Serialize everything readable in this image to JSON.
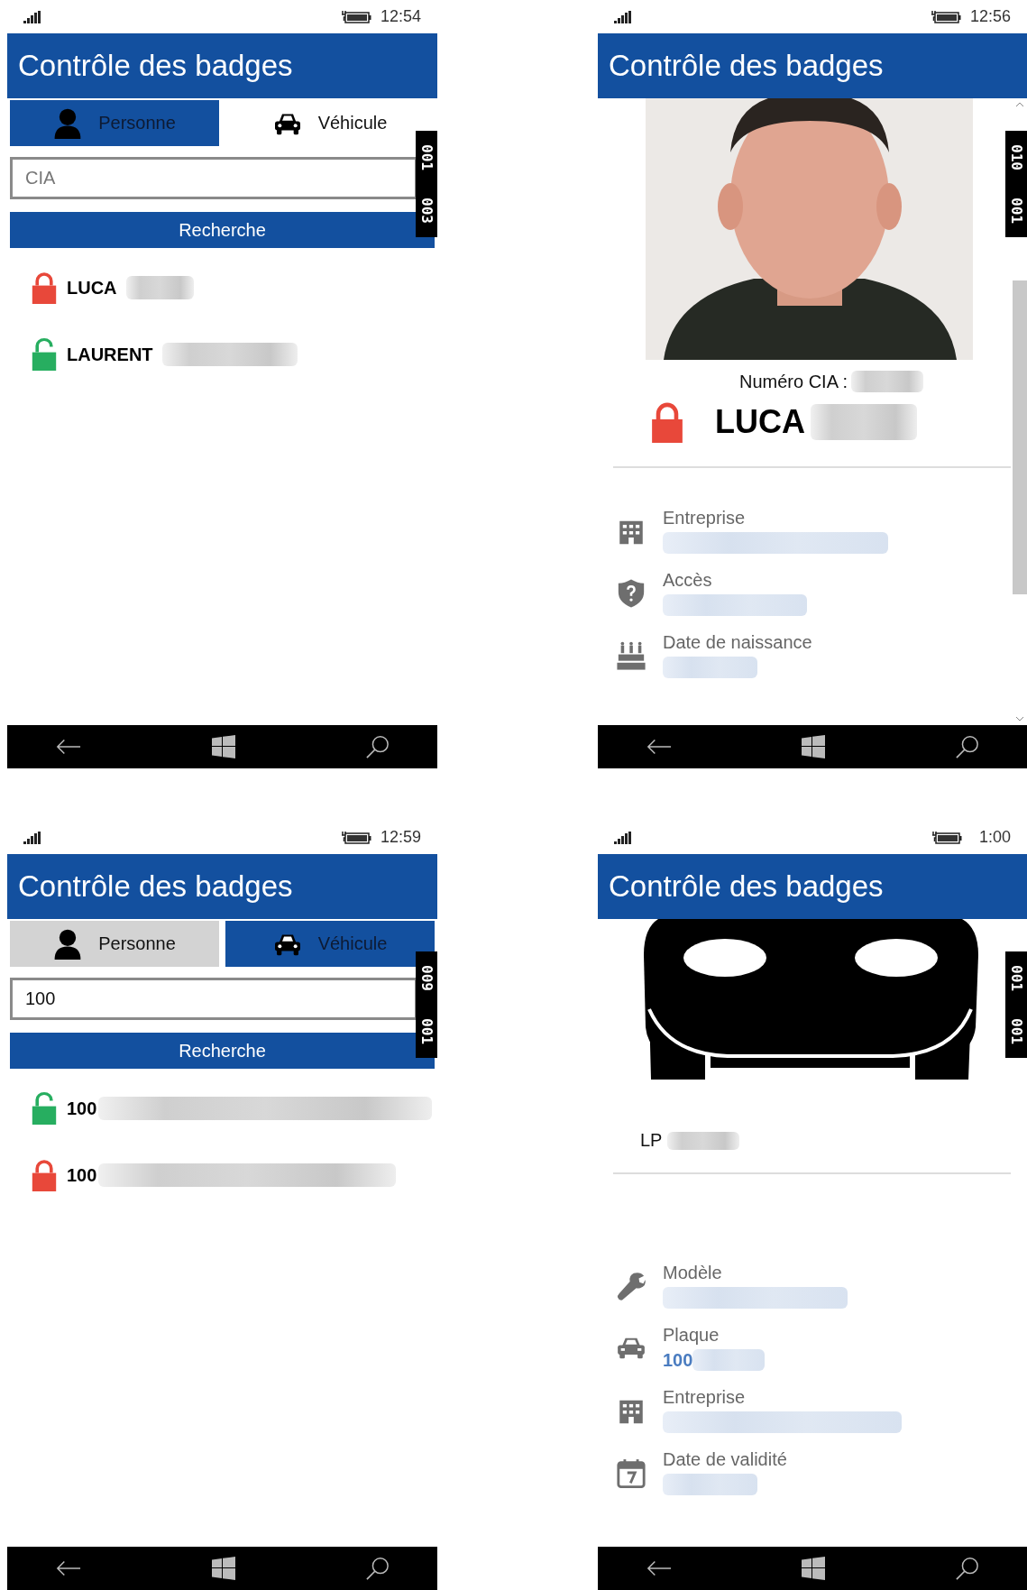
{
  "screens": [
    {
      "kind": "search",
      "time": "12:54",
      "title": "Contrôle des badges",
      "tabs": [
        {
          "label": "Personne",
          "selected": true,
          "pressed": false
        },
        {
          "label": "Véhicule",
          "selected": false,
          "pressed": false
        }
      ],
      "search": {
        "placeholder": "CIA"
      },
      "button": "Recherche",
      "results": [
        {
          "name": "LUCA",
          "locked": true
        },
        {
          "name": "LAURENT",
          "locked": false
        }
      ],
      "counter": [
        "001",
        "003"
      ]
    },
    {
      "kind": "person_detail",
      "time": "12:56",
      "title": "Contrôle des badges",
      "number_label": "Numéro CIA :",
      "locked": true,
      "name": "LUCA",
      "fields": [
        {
          "kind": "company",
          "label": "Entreprise"
        },
        {
          "kind": "access",
          "label": "Accès"
        },
        {
          "kind": "birthday",
          "label": "Date de naissance"
        }
      ],
      "counter": [
        "010",
        "001"
      ]
    },
    {
      "kind": "search",
      "time": "12:59",
      "title": "Contrôle des badges",
      "tabs": [
        {
          "label": "Personne",
          "selected": false,
          "pressed": true
        },
        {
          "label": "Véhicule",
          "selected": true,
          "pressed": false
        }
      ],
      "search": {
        "value": "100"
      },
      "button": "Recherche",
      "results": [
        {
          "name": "100",
          "locked": false
        },
        {
          "name": "100",
          "locked": true
        }
      ],
      "counter": [
        "009",
        "001"
      ]
    },
    {
      "kind": "vehicle_detail",
      "time": "1:00",
      "title": "Contrôle des badges",
      "plate_label": "LP",
      "fields": [
        {
          "kind": "model",
          "label": "Modèle"
        },
        {
          "kind": "plate",
          "label": "Plaque",
          "value": "100"
        },
        {
          "kind": "company",
          "label": "Entreprise"
        },
        {
          "kind": "validity",
          "label": "Date de validité"
        }
      ],
      "counter": [
        "001",
        "001"
      ]
    }
  ]
}
